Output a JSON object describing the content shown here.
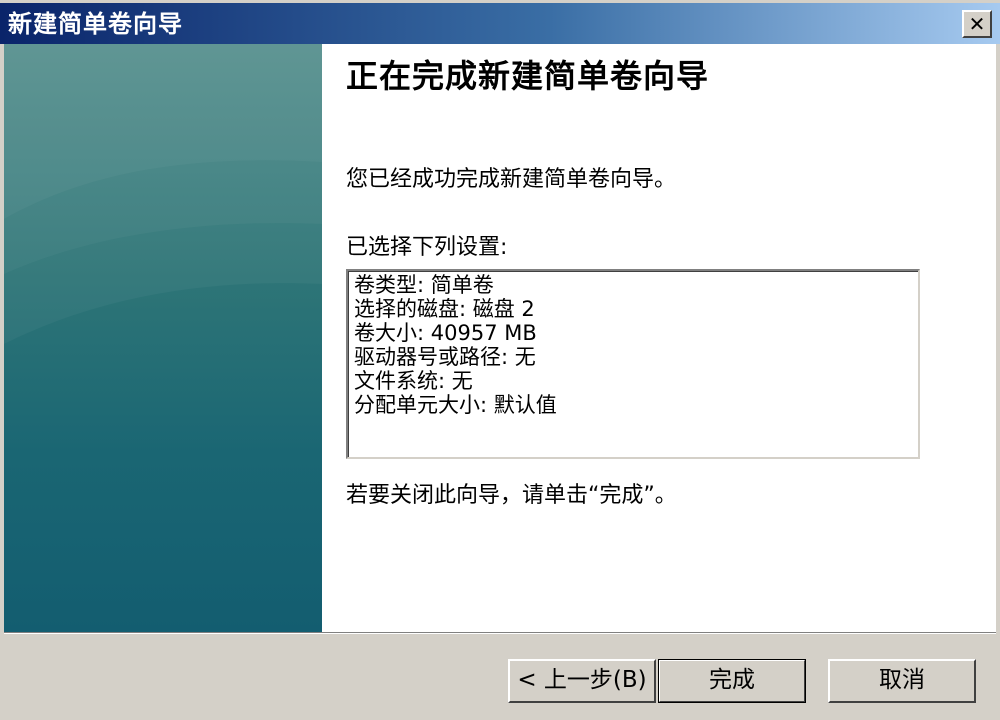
{
  "window": {
    "title": "新建简单卷向导",
    "close_glyph": "✕"
  },
  "content": {
    "heading": "正在完成新建简单卷向导",
    "completed_message": "您已经成功完成新建简单卷向导。",
    "settings_label": "已选择下列设置:",
    "settings": [
      "卷类型: 简单卷",
      "选择的磁盘: 磁盘 2",
      "卷大小: 40957 MB",
      "驱动器号或路径: 无",
      "文件系统: 无",
      "分配单元大小: 默认值"
    ],
    "close_hint": "若要关闭此向导，请单击“完成”。"
  },
  "buttons": {
    "back_label": "< 上一步(B)",
    "finish_label": "完成",
    "cancel_label": "取消"
  },
  "colors": {
    "titlebar_start": "#0a246a",
    "titlebar_end": "#a6caf0",
    "side_panel": "#1a6673",
    "dialog_face": "#d4d0c8"
  }
}
